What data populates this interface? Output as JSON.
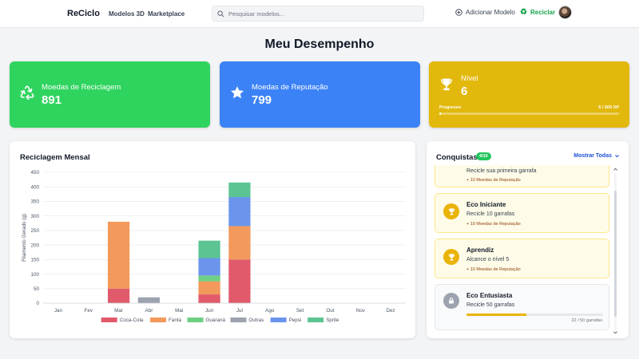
{
  "nav": {
    "brand": "ReCiclo",
    "links": [
      "Modelos 3D",
      "Marketplace"
    ],
    "search_placeholder": "Pesquisar modelos...",
    "add_model": "Adicionar Modelo",
    "recycle": "Reciclar"
  },
  "page_title": "Meu Desempenho",
  "stats": {
    "recycle_coins": {
      "label": "Moedas de Reciclagem",
      "value": "891",
      "color": "#22c55e",
      "icon": "recycle-icon"
    },
    "reputation_coins": {
      "label": "Moedas de Reputação",
      "value": "799",
      "color": "#3b82f6",
      "icon": "star-icon"
    },
    "level": {
      "label": "Nível",
      "value": "6",
      "color": "#eab308",
      "icon": "trophy-icon",
      "progress_label": "Progresso",
      "progress_value": "5 / 600 XP",
      "progress_fraction": 0.008
    }
  },
  "chart": {
    "title": "Reciclagem Mensal"
  },
  "chart_data": {
    "type": "bar",
    "stacked": true,
    "categories": [
      "Jan",
      "Fev",
      "Mar",
      "Abr",
      "Mai",
      "Jun",
      "Jul",
      "Ago",
      "Set",
      "Out",
      "Nov",
      "Dez"
    ],
    "ylabel": "Filamento Gerado (g)",
    "ylim": [
      0,
      450
    ],
    "yticks": [
      0,
      50,
      100,
      150,
      200,
      250,
      300,
      350,
      400,
      450
    ],
    "grid": true,
    "legend_position": "bottom",
    "series": [
      {
        "name": "Coca-Cola",
        "color": "#e15a6b",
        "values": [
          0,
          0,
          50,
          0,
          0,
          30,
          150,
          0,
          0,
          0,
          0,
          0
        ]
      },
      {
        "name": "Fanta",
        "color": "#f2995b",
        "values": [
          0,
          0,
          230,
          0,
          0,
          45,
          115,
          0,
          0,
          0,
          0,
          0
        ]
      },
      {
        "name": "Guaraná",
        "color": "#6fcf82",
        "values": [
          0,
          0,
          0,
          0,
          0,
          20,
          0,
          0,
          0,
          0,
          0,
          0
        ]
      },
      {
        "name": "Outras",
        "color": "#9ca3af",
        "values": [
          0,
          0,
          0,
          20,
          0,
          0,
          0,
          0,
          0,
          0,
          0,
          0
        ]
      },
      {
        "name": "Pepsi",
        "color": "#6b94ec",
        "values": [
          0,
          0,
          0,
          0,
          0,
          60,
          100,
          0,
          0,
          0,
          0,
          0
        ]
      },
      {
        "name": "Sprite",
        "color": "#5cc493",
        "values": [
          0,
          0,
          0,
          0,
          0,
          60,
          50,
          0,
          0,
          0,
          0,
          0
        ]
      }
    ]
  },
  "achievements": {
    "title": "Conquistas",
    "count": "4/10",
    "toggle": "Mostrar Todas",
    "items": [
      {
        "name": "",
        "desc": "Recicle sua primeira garrafa",
        "reward": "+ 10 Moedas de Reputação",
        "locked": false
      },
      {
        "name": "Eco Iniciante",
        "desc": "Recicle 10 garrafas",
        "reward": "+ 10 Moedas de Reputação",
        "locked": false
      },
      {
        "name": "Aprendiz",
        "desc": "Alcance o nível 5",
        "reward": "+ 10 Moedas de Reputação",
        "locked": false
      },
      {
        "name": "Eco Entusiasta",
        "desc": "Recicle 50 garrafas",
        "progress_text": "22 / 50 garrafas",
        "progress_fraction": 0.44,
        "locked": true
      }
    ]
  }
}
